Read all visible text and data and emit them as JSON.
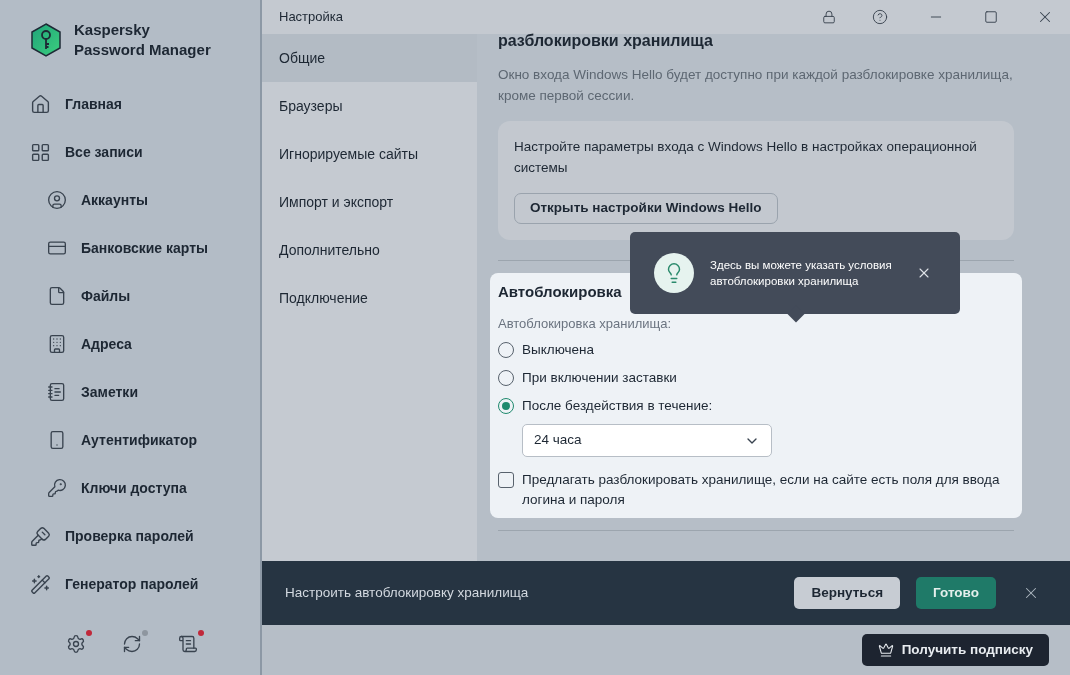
{
  "app": {
    "logo_lines": [
      "Kaspersky",
      "Password Manager"
    ]
  },
  "sidebar": {
    "items": [
      {
        "label": "Главная",
        "selected": false
      },
      {
        "label": "Все записи",
        "selected": false,
        "children": [
          {
            "label": "Аккаунты",
            "selected": false
          },
          {
            "label": "Банковские карты",
            "selected": false
          },
          {
            "label": "Файлы",
            "selected": false
          },
          {
            "label": "Адреса",
            "selected": false
          },
          {
            "label": "Заметки",
            "selected": false
          },
          {
            "label": "Аутентификатор",
            "selected": false
          },
          {
            "label": "Ключи доступа",
            "selected": false
          }
        ]
      },
      {
        "label": "Проверка паролей",
        "selected": false
      },
      {
        "label": "Генератор паролей",
        "selected": false
      }
    ],
    "footer_icons": [
      {
        "color": "#c0283a"
      },
      {
        "color": "#8e969f"
      },
      {
        "color": "#c0283a"
      }
    ]
  },
  "window": {
    "title": "Настройка"
  },
  "settings_nav": [
    {
      "label": "Общие",
      "selected": true
    },
    {
      "label": "Браузеры",
      "selected": false
    },
    {
      "label": "Игнорируемые сайты",
      "selected": false
    },
    {
      "label": "Импорт и экспорт",
      "selected": false
    },
    {
      "label": "Дополнительно",
      "selected": false
    },
    {
      "label": "Подключение",
      "selected": false
    }
  ],
  "content": {
    "heading": "разблокировки хранилища",
    "description": "Окно входа Windows Hello будет доступно при каждой разблокировке хранилища, кроме первой сессии.",
    "hello_card": {
      "text": "Настройте параметры входа с Windows Hello в настройках операционной системы",
      "button": "Открыть настройки Windows Hello"
    },
    "autolock": {
      "title": "Автоблокировка",
      "field_label": "Автоблокировка хранилища:",
      "options": [
        {
          "label": "Выключена",
          "selected": false
        },
        {
          "label": "При включении заставки",
          "selected": false
        },
        {
          "label": "После бездействия в течение:",
          "selected": true
        }
      ],
      "select": {
        "value": "24 часа"
      },
      "checkbox": {
        "label": "Предлагать разблокировать хранилище, если на сайте есть поля для ввода логина и пароля",
        "checked": false
      }
    }
  },
  "tooltip": {
    "text": "Здесь вы можете указать условия автоблокировки хранилища"
  },
  "banner": {
    "text": "Настроить автоблокировку хранилища",
    "buttons": [
      {
        "label": "Вернуться",
        "kind": "secondary"
      },
      {
        "label": "Готово",
        "kind": "primary"
      }
    ]
  },
  "subscribe_button": {
    "label": "Получить подписку"
  }
}
